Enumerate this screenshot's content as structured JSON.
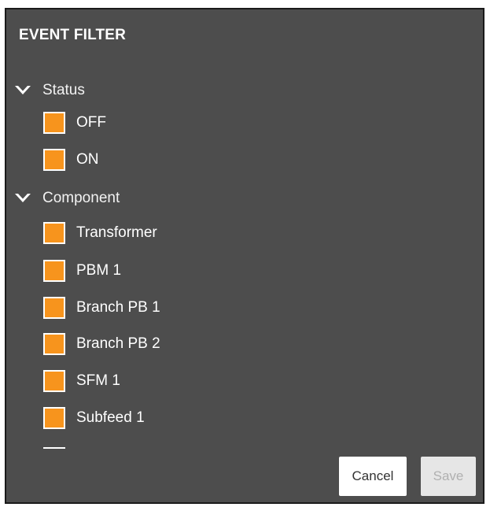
{
  "dialog": {
    "title": "EVENT FILTER"
  },
  "groups": [
    {
      "label": "Status",
      "items": [
        "OFF",
        "ON"
      ]
    },
    {
      "label": "Component",
      "items": [
        "Transformer",
        "PBM 1",
        "Branch PB 1",
        "Branch PB 2",
        "SFM 1",
        "Subfeed 1"
      ]
    }
  ],
  "buttons": {
    "cancel": "Cancel",
    "save": "Save"
  },
  "colors": {
    "panel": "#4d4d4d",
    "checkbox": "#f7941d",
    "text": "#ffffff"
  },
  "icons": {
    "group_toggle": "chevron-down-icon",
    "checkbox": "checkbox-checked-icon"
  }
}
